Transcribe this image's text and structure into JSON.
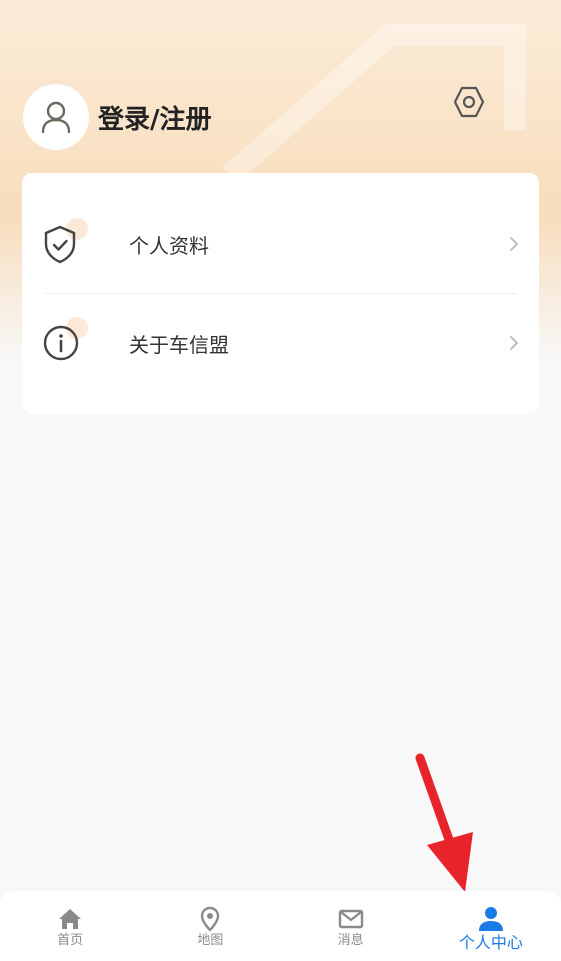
{
  "profile": {
    "login_label": "登录/注册"
  },
  "menu": {
    "items": [
      {
        "label": "个人资料",
        "icon": "shield-check-icon"
      },
      {
        "label": "关于车信盟",
        "icon": "info-icon"
      }
    ]
  },
  "tabbar": {
    "tabs": [
      {
        "label": "首页",
        "icon": "home-icon",
        "active": false
      },
      {
        "label": "地图",
        "icon": "map-pin-icon",
        "active": false
      },
      {
        "label": "消息",
        "icon": "mail-icon",
        "active": false
      },
      {
        "label": "个人中心",
        "icon": "user-icon",
        "active": true
      }
    ]
  },
  "colors": {
    "accent": "#1b7be6",
    "annotation_arrow": "#e8232b",
    "header_gradient": "#f8ddbc"
  }
}
